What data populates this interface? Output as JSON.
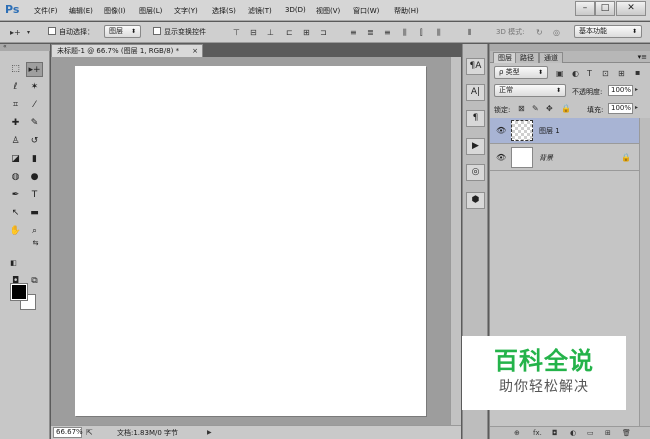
{
  "app": {
    "logo": "Ps"
  },
  "menu": [
    "文件(F)",
    "编辑(E)",
    "图像(I)",
    "图层(L)",
    "文字(Y)",
    "选择(S)",
    "滤镜(T)",
    "3D(D)",
    "视图(V)",
    "窗口(W)",
    "帮助(H)"
  ],
  "window_buttons": {
    "minimize": "–",
    "maximize": "□",
    "close": "✕"
  },
  "options": {
    "auto_select_label": "自动选择：",
    "auto_select_value": "图层",
    "show_transform_label": "显示变换控件",
    "mode_3d_label": "3D 模式:",
    "workspace": "基本功能"
  },
  "tools": {
    "move": "▸+",
    "marquee": "⬚",
    "lasso": "ℓ",
    "magic_wand": "✶",
    "crop": "⌗",
    "eyedropper": "⁄",
    "healing": "✚",
    "brush": "✎",
    "stamp": "♙",
    "history_brush": "↺",
    "eraser": "◪",
    "gradient": "▮",
    "blur": "◍",
    "dodge": "●",
    "pen": "✒",
    "type": "T",
    "path_select": "↖",
    "shape": "▬",
    "hand": "✋",
    "zoom": "⌕",
    "swap": "⇆",
    "default_colors": "◧",
    "quick_mask": "◘",
    "screen_mode": "⧉"
  },
  "colors": {
    "foreground": "#000000",
    "background": "#ffffff",
    "watermark_green": "#24b34a"
  },
  "document": {
    "tab_title": "未标题-1 @ 66.7% (图层 1, RGB/8) *",
    "tab_close": "×"
  },
  "status": {
    "zoom": "66.67%",
    "doc_info": "文档:1.83M/0 字节",
    "arrow": "▶"
  },
  "icon_column": [
    "¶A",
    "A|",
    "¶",
    "▶",
    "◎",
    "⬢"
  ],
  "layers_panel": {
    "tabs": [
      "图层",
      "路径",
      "通道"
    ],
    "filter_label": "ρ 类型",
    "blend_mode": "正常",
    "opacity_label": "不透明度:",
    "opacity_value": "100%",
    "lock_label": "锁定:",
    "fill_label": "填充:",
    "fill_value": "100%",
    "layers": [
      {
        "name": "图层 1",
        "selected": true
      },
      {
        "name": "背景",
        "selected": false
      }
    ],
    "bottom_icons": [
      "⊕",
      "fx.",
      "◘",
      "◐",
      "▭",
      "⊞",
      "🗑"
    ]
  },
  "watermark": {
    "main": "百科全说",
    "sub": "助你轻松解决"
  }
}
